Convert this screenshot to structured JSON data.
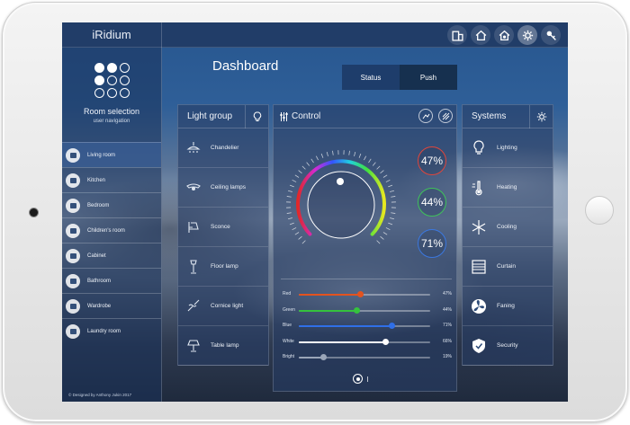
{
  "app": {
    "brand": "iRidium",
    "credit": "© Designed by Anthony Jukin 2017"
  },
  "topbar": {
    "icons": [
      "building-icon",
      "home-icon",
      "house-settings-icon",
      "gear-icon",
      "key-user-icon"
    ],
    "active_icon": "gear-icon"
  },
  "sidebar": {
    "title": "Room selection",
    "subtitle": "user navigation",
    "rooms": [
      {
        "label": "Living room",
        "icon": "sofa-icon",
        "active": true
      },
      {
        "label": "Kitchen",
        "icon": "pot-icon"
      },
      {
        "label": "Bedroom",
        "icon": "bed-icon"
      },
      {
        "label": "Children's room",
        "icon": "toy-icon"
      },
      {
        "label": "Cabinet",
        "icon": "desk-lamp-icon"
      },
      {
        "label": "Bathroom",
        "icon": "bathtub-icon"
      },
      {
        "label": "Wardrobe",
        "icon": "hanger-icon"
      },
      {
        "label": "Laundry room",
        "icon": "washing-machine-icon"
      }
    ]
  },
  "dashboard": {
    "title": "Dashboard",
    "tabs": [
      "Status",
      "Push"
    ],
    "active_tab": "Push"
  },
  "light_group": {
    "title": "Light group",
    "items": [
      "Chandelier",
      "Ceiling lamps",
      "Sconce",
      "Floor lamp",
      "Cornice light",
      "Table lamp"
    ]
  },
  "control": {
    "title": "Control",
    "readouts": [
      {
        "value": "47%",
        "color": "#e0463c"
      },
      {
        "value": "44%",
        "color": "#3fc35a"
      },
      {
        "value": "71%",
        "color": "#3b78e0"
      }
    ],
    "sliders": [
      {
        "label": "Red",
        "value_text": "47%",
        "level": 0.47,
        "color": "#e3531f"
      },
      {
        "label": "Green",
        "value_text": "44%",
        "level": 0.44,
        "color": "#35c23d"
      },
      {
        "label": "Blue",
        "value_text": "71%",
        "level": 0.71,
        "color": "#2f6fe8"
      },
      {
        "label": "White",
        "value_text": "66%",
        "level": 0.66,
        "color": "#ffffff"
      },
      {
        "label": "Bright",
        "value_text": "19%",
        "level": 0.19,
        "color": "#9aa6b8"
      }
    ]
  },
  "systems": {
    "title": "Systems",
    "items": [
      "Lighting",
      "Heating",
      "Cooling",
      "Curtain",
      "Faning",
      "Security"
    ]
  }
}
